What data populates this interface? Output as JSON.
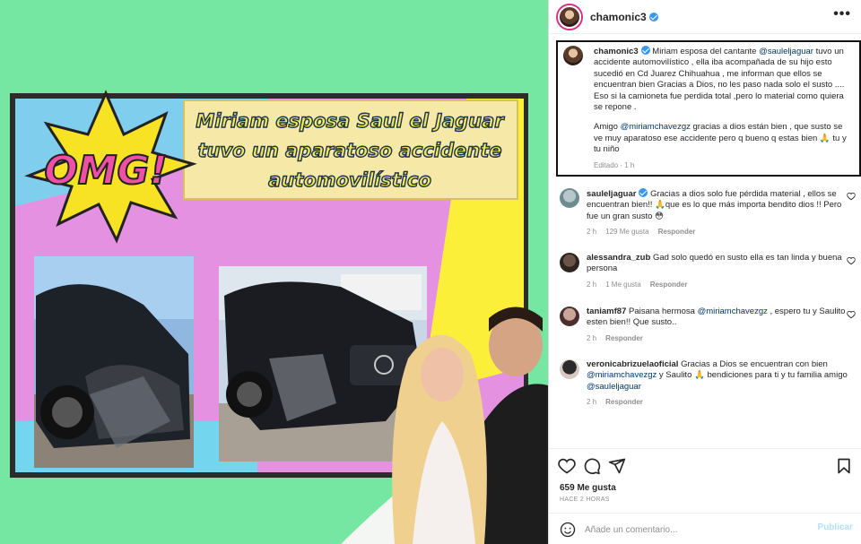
{
  "media": {
    "burst_text": "OMG!",
    "headline_lines": [
      "Miriam esposa Saul el Jaguar",
      "tuvo un aparatoso accidente",
      "automovilístico"
    ],
    "colors": {
      "background": "#76e6a3",
      "frame": "#2c2c2c",
      "pink": "#e391e0",
      "yellow": "#fbef3a",
      "cyan": "#73d5ee",
      "headline_fill": "#f3e56a",
      "burst_text": "#f04fa6"
    },
    "icons": [
      "star-burst-icon"
    ]
  },
  "post": {
    "username": "chamonic3",
    "more_icon": "•••",
    "caption": {
      "username": "chamonic3",
      "p1_before": "Miriam esposa del cantante ",
      "p1_mention": "@sauleljaguar",
      "p1_after": " tuvo un accidente automovilístico , ella iba acompañada de su hijo esto sucedió en Cd Juarez Chihuahua , me informan que ellos se encuentran bien Gracias a Dios, no les paso nada solo el susto .... Eso si la camioneta fue perdida total ,pero lo material como quiera se repone .",
      "p2_before": "Amigo ",
      "p2_mention": "@miriamchavezgz",
      "p2_after": " gracias a dios están bien , que susto se ve muy aparatoso ese accidente pero q bueno q estas bien 🙏 tu y tu niño",
      "meta": "Editado · 1 h"
    },
    "comments": [
      {
        "username": "sauleljaguar",
        "verified": true,
        "text": "Gracias a dios solo fue pérdida material , ellos se encuentran bien!! 🙏que es lo que más importa bendito dios !! Pero fue un gran susto 😳",
        "time": "2 h",
        "likes": "129 Me gusta",
        "reply": "Responder"
      },
      {
        "username": "alessandra_zub",
        "text": "Gad solo quedó en susto ella es tan linda y buena persona",
        "time": "2 h",
        "likes": "1 Me gusta",
        "reply": "Responder"
      },
      {
        "username": "taniamf87",
        "text_before": "Paisana hermosa ",
        "mention": "@miriamchavezgz",
        "text_after": " , espero tu y Saulito esten bien!! Que susto..",
        "time": "2 h",
        "reply": "Responder"
      },
      {
        "username": "veronicabrizuelaoficial",
        "text_before": "Gracias a Dios se encuentran con bien ",
        "mention": "@miriamchavezgz",
        "text_mid": " y Saulito 🙏 bendiciones para ti y tu familia amigo ",
        "mention2": "@sauleljaguar",
        "time": "2 h",
        "reply": "Responder"
      }
    ],
    "likes": "659 Me gusta",
    "time_ago": "HACE 2 HORAS",
    "add_comment_placeholder": "Añade un comentario...",
    "publish": "Publicar"
  }
}
